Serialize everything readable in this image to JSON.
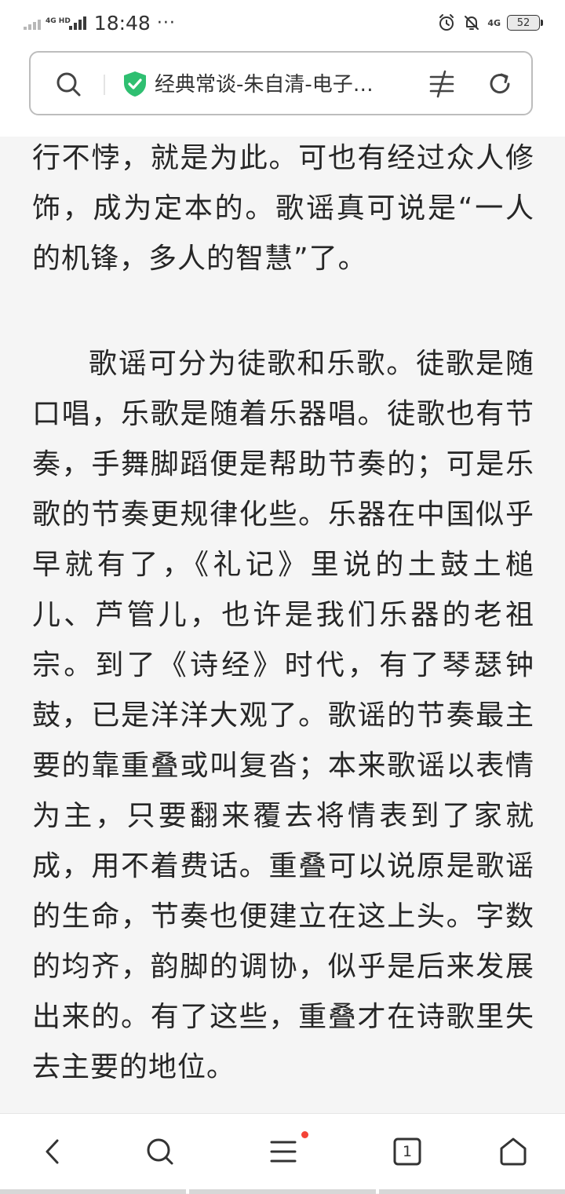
{
  "status_bar": {
    "time": "18:48",
    "more_indicator": "···",
    "network_left": "4G HD",
    "network_right": "4G",
    "battery": "52",
    "icons": [
      "signal-weak-icon",
      "signal-strong-icon",
      "alarm-icon",
      "mute-icon",
      "network-icon",
      "battery-icon"
    ]
  },
  "address_bar": {
    "title": "经典常谈-朱自清-电子…",
    "icons": [
      "search-icon",
      "secure-shield-icon",
      "reader-mode-icon",
      "refresh-icon"
    ],
    "secure_color": "#2fbf71"
  },
  "content": {
    "paragraph_1": "行不悖，就是为此。可也有经过众人修饰，成为定本的。歌谣真可说是“一人的机锋，多人的智慧”了。",
    "paragraph_2": "歌谣可分为徒歌和乐歌。徒歌是随口唱，乐歌是随着乐器唱。徒歌也有节奏，手舞脚蹈便是帮助节奏的；可是乐歌的节奏更规律化些。乐器在中国似乎早就有了，《礼记》里说的土鼓土槌儿、芦管儿，也许是我们乐器的老祖宗。到了《诗经》时代，有了琴瑟钟鼓，已是洋洋大观了。歌谣的节奏最主要的靠重叠或叫复沓；本来歌谣以表情为主，只要翻来覆去将情表到了家就成，用不着费话。重叠可以说原是歌谣的生命，节奏也便建立在这上头。字数的均齐，韵脚的调协，似乎是后来发展出来的。有了这些，重叠才在诗歌里失去主要的地位。"
  },
  "bottom_nav": {
    "items": [
      "back-icon",
      "search-icon",
      "menu-icon",
      "tabs-icon",
      "home-icon"
    ],
    "tab_count": "1",
    "notification_color": "#f44336"
  }
}
